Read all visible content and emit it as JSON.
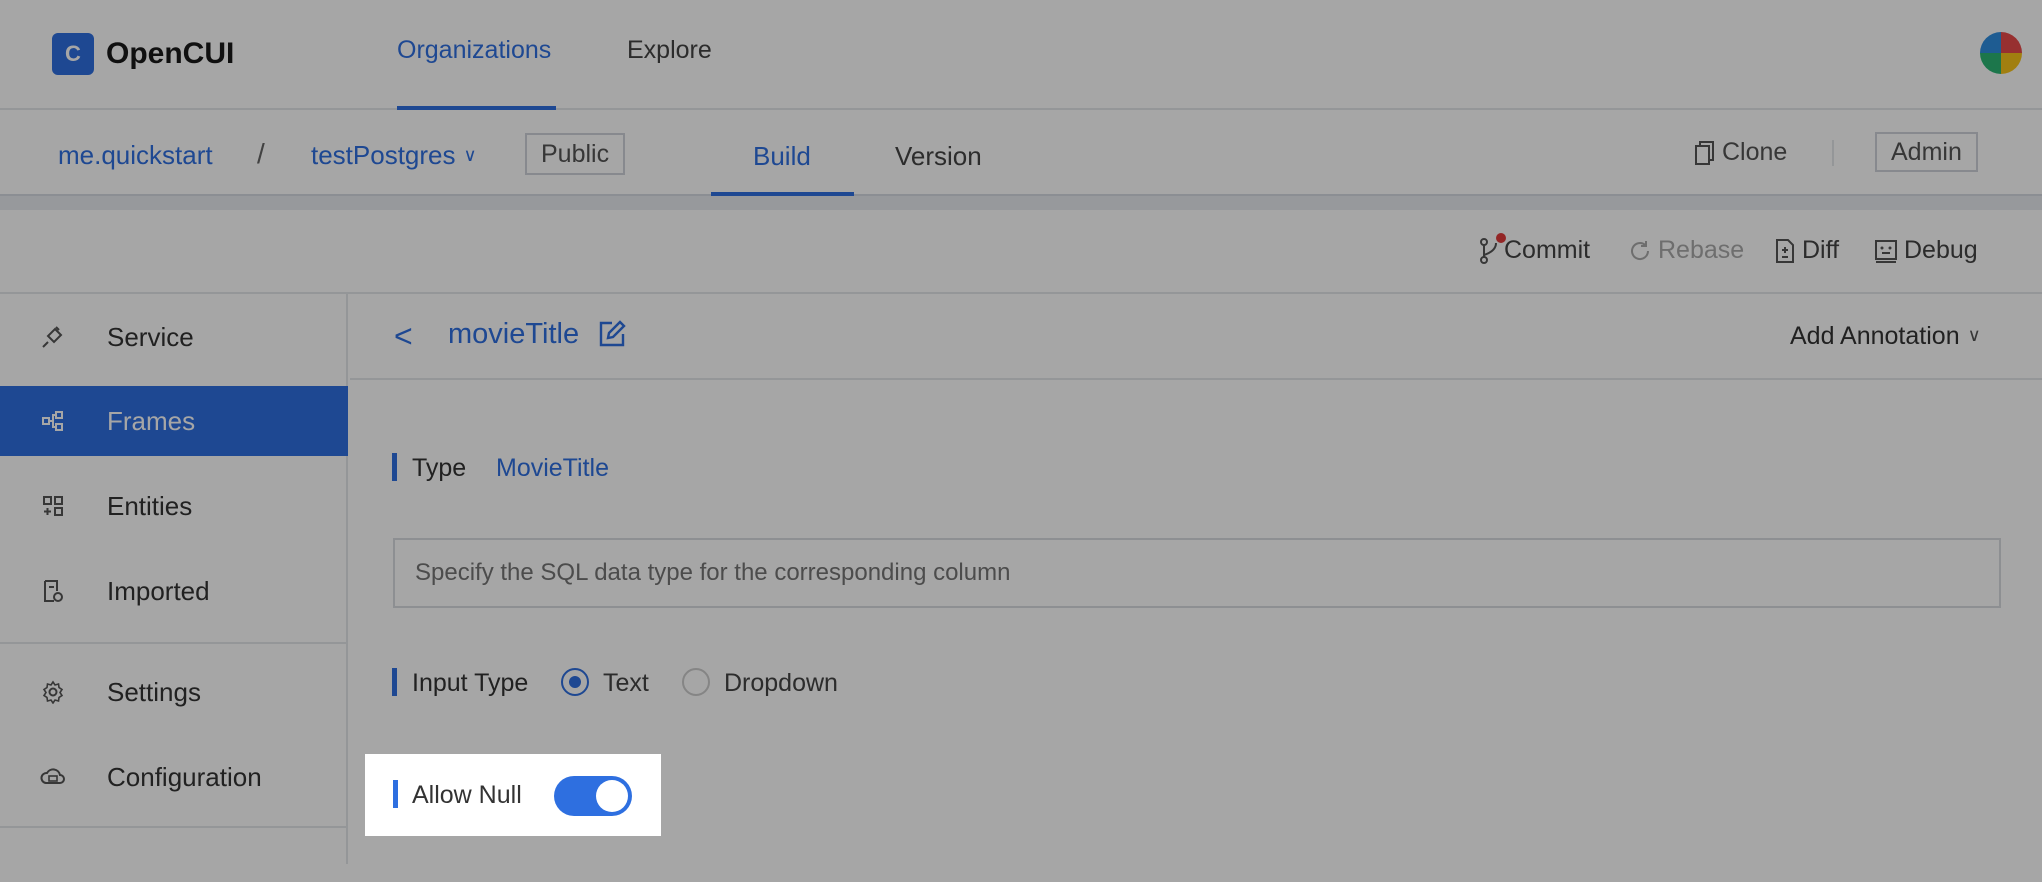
{
  "app": {
    "name": "OpenCUI",
    "logo_glyph": "C"
  },
  "topnav": {
    "tabs": [
      "Organizations",
      "Explore"
    ],
    "active": "Organizations"
  },
  "subnav": {
    "org": "me.quickstart",
    "separator": "/",
    "project": "testPostgres",
    "visibility": "Public",
    "tabs": [
      "Build",
      "Version"
    ],
    "active": "Build",
    "clone_label": "Clone",
    "admin_label": "Admin"
  },
  "toolbar": {
    "commit": "Commit",
    "rebase": "Rebase",
    "diff": "Diff",
    "debug": "Debug"
  },
  "sidebar": {
    "items": [
      {
        "label": "Service",
        "icon": "plug-icon"
      },
      {
        "label": "Frames",
        "icon": "frames-icon",
        "active": true
      },
      {
        "label": "Entities",
        "icon": "entities-icon"
      },
      {
        "label": "Imported",
        "icon": "imported-icon"
      },
      {
        "label": "Settings",
        "icon": "gear-icon"
      },
      {
        "label": "Configuration",
        "icon": "cloud-config-icon"
      }
    ]
  },
  "main": {
    "back_glyph": "<",
    "title": "movieTitle",
    "annotation_label": "Add Annotation",
    "type_label": "Type",
    "type_value": "MovieTitle",
    "sql_placeholder": "Specify the SQL data type for the corresponding column",
    "input_type_label": "Input Type",
    "input_type_options": [
      "Text",
      "Dropdown"
    ],
    "input_type_selected": "Text",
    "allow_null_label": "Allow Null",
    "allow_null_on": true
  },
  "colors": {
    "accent": "#2e6fe0",
    "dim": "rgba(0,0,0,0.35)"
  }
}
